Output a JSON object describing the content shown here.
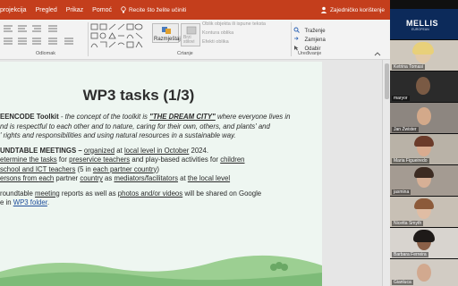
{
  "ribbon_tabs": {
    "t1": "projekcija",
    "t2": "Pregled",
    "t3": "Prikaz",
    "t4": "Pomoć",
    "tell_me": "Recite što želite učiniti",
    "share": "Zajedničko korištenje"
  },
  "ribbon": {
    "group_paragraph": "Odlomak",
    "group_drawing": "Crtanje",
    "group_editing": "Uređivanje",
    "arrange": "Razmještaj",
    "quick_styles": "Brzi stilovi",
    "shape_fill": "Oblik objekta ili ispune teksta",
    "shape_outline": "Kontura oblika",
    "shape_effects": "Efekti oblika",
    "find": "Traženje",
    "replace": "Zamjena",
    "select": "Odabir"
  },
  "slide": {
    "title": "WP3 tasks (1/3)",
    "line1_bold": "EENCODE Toolkit",
    "line1_rest": " - the concept of the toolkit is ",
    "line1_city": "\"THE DREAM CITY\"",
    "line1_end": " where everyone lives in",
    "line2": "nd is respectful to each other and to nature, caring for their own, others, and plants' and",
    "line3": "' rights and responsibilities and using natural resources in a sustainable way.",
    "line4_bold": "UNDTABLE MEETINGS",
    "line4_dash": " – ",
    "line4_org": "organized",
    "line4_at": " at ",
    "line4_local": "local level in October",
    "line4_year": " 2024.",
    "line5_a": "etermine the tasks",
    "line5_b": " for ",
    "line5_c": "preservice teachers",
    "line5_d": " and play-based activities for ",
    "line5_e": "children",
    "line6_a": "school and ICT ",
    "line6_b": "teachers",
    "line6_c": " (5 in ",
    "line6_d": "each partner country",
    "line6_e": ")",
    "line7_a": "ersons from ",
    "line7_b": "each",
    "line7_c": " partner ",
    "line7_d": "country",
    "line7_e": " as ",
    "line7_f": "mediators/facilitators",
    "line7_g": " at ",
    "line7_h": "the local level",
    "line8_a": " roundtable ",
    "line8_b": "meeting",
    "line8_c": " reports as well as ",
    "line8_d": "photos and/or videos",
    "line8_e": " will be shared on Google",
    "line9_a": "e in ",
    "line9_b": "WP3 folder",
    "line9_c": "."
  },
  "participants": [
    {
      "name": "",
      "label": "MELLIS"
    },
    {
      "name": "Ketrina Tomasi"
    },
    {
      "name": "maryor"
    },
    {
      "name": "Jan Zwister"
    },
    {
      "name": "Maria Figueiredo"
    },
    {
      "name": "jasmina"
    },
    {
      "name": "Nicetta Smyth"
    },
    {
      "name": "Barbara Ferreira"
    },
    {
      "name": "Gianluca"
    }
  ],
  "logo_subtitle": "EUROPEAN",
  "colors": {
    "ribbon_accent": "#c43e1c",
    "slide_background": "#eef6f1",
    "hill_green": "#7dbb78",
    "link_blue": "#1f4e9c"
  }
}
